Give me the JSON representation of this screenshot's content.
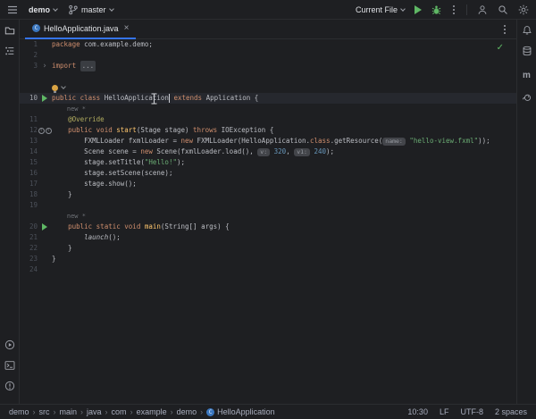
{
  "titlebar": {
    "project_name": "demo",
    "branch_name": "master",
    "run_config": "Current File"
  },
  "tab_bar": {
    "active_tab": "HelloApplication.java"
  },
  "icons": {
    "close": "×",
    "check": "✓",
    "fold_arrow": "›",
    "override_arrow": "↑",
    "breadcrumb_separator": "›",
    "class_letter": "C",
    "maven": "m"
  },
  "colors": {
    "accent_blue": "#3574F0",
    "run_green": "#5FB865",
    "keyword_orange": "#CF8E6D",
    "string_green": "#6AAB73",
    "number_blue": "#6897BB",
    "annotation_yellow": "#B3AE60",
    "method_yellow": "#FFC66D",
    "background": "#1E1F22"
  },
  "editor": {
    "rows": [
      {
        "n": "1",
        "seg": [
          {
            "t": "package ",
            "c": "kw"
          },
          {
            "t": "com.example.demo;",
            "c": "def"
          }
        ]
      },
      {
        "n": "2",
        "seg": []
      },
      {
        "n": "3",
        "gutter": "fold",
        "seg": [
          {
            "t": "import ",
            "c": "kw"
          },
          {
            "t": "...",
            "c": "fold"
          }
        ]
      },
      {
        "n": "",
        "seg": []
      },
      {
        "n": "",
        "bulb": true,
        "seg": []
      },
      {
        "n": "10",
        "current": true,
        "gutter": "run",
        "seg": [
          {
            "t": "public class ",
            "c": "kw"
          },
          {
            "t": "HelloApplication",
            "c": "def"
          },
          {
            "caret": true
          },
          {
            "t": " ",
            "c": "def"
          },
          {
            "t": "extends",
            "c": "kw"
          },
          {
            "t": " Application {",
            "c": "def"
          }
        ]
      },
      {
        "n": "",
        "seg": [
          {
            "t": "    new *",
            "c": "vision"
          }
        ]
      },
      {
        "n": "11",
        "seg": [
          {
            "t": "    ",
            "c": "def"
          },
          {
            "t": "@Override",
            "c": "ann"
          }
        ]
      },
      {
        "n": "12",
        "gutter": "override",
        "seg": [
          {
            "t": "    ",
            "c": "def"
          },
          {
            "t": "public void ",
            "c": "kw"
          },
          {
            "t": "start",
            "c": "mth"
          },
          {
            "t": "(Stage stage) ",
            "c": "def"
          },
          {
            "t": "throws",
            "c": "kw"
          },
          {
            "t": " IOException {",
            "c": "def"
          }
        ]
      },
      {
        "n": "13",
        "seg": [
          {
            "t": "        FXMLLoader fxmlLoader = ",
            "c": "def"
          },
          {
            "t": "new",
            "c": "kw"
          },
          {
            "t": " FXMLLoader(HelloApplication.",
            "c": "def"
          },
          {
            "t": "class",
            "c": "kw"
          },
          {
            "t": ".getResource(",
            "c": "def"
          },
          {
            "t": "name:",
            "c": "chip"
          },
          {
            "t": " ",
            "c": "def"
          },
          {
            "t": "\"hello-view.fxml\"",
            "c": "str"
          },
          {
            "t": "));",
            "c": "def"
          }
        ]
      },
      {
        "n": "14",
        "seg": [
          {
            "t": "        Scene scene = ",
            "c": "def"
          },
          {
            "t": "new",
            "c": "kw"
          },
          {
            "t": " Scene(fxmlLoader.load(), ",
            "c": "def"
          },
          {
            "t": "v:",
            "c": "chip"
          },
          {
            "t": " ",
            "c": "def"
          },
          {
            "t": "320",
            "c": "num"
          },
          {
            "t": ", ",
            "c": "def"
          },
          {
            "t": "v1:",
            "c": "chip"
          },
          {
            "t": " ",
            "c": "def"
          },
          {
            "t": "240",
            "c": "num"
          },
          {
            "t": ");",
            "c": "def"
          }
        ]
      },
      {
        "n": "15",
        "seg": [
          {
            "t": "        stage.setTitle(",
            "c": "def"
          },
          {
            "t": "\"Hello!\"",
            "c": "str"
          },
          {
            "t": ");",
            "c": "def"
          }
        ]
      },
      {
        "n": "16",
        "seg": [
          {
            "t": "        stage.setScene(scene);",
            "c": "def"
          }
        ]
      },
      {
        "n": "17",
        "seg": [
          {
            "t": "        stage.show();",
            "c": "def"
          }
        ]
      },
      {
        "n": "18",
        "seg": [
          {
            "t": "    }",
            "c": "def"
          }
        ]
      },
      {
        "n": "19",
        "seg": []
      },
      {
        "n": "",
        "seg": [
          {
            "t": "    new *",
            "c": "vision"
          }
        ]
      },
      {
        "n": "20",
        "gutter": "run",
        "seg": [
          {
            "t": "    ",
            "c": "def"
          },
          {
            "t": "public static void ",
            "c": "kw"
          },
          {
            "t": "main",
            "c": "mth"
          },
          {
            "t": "(String[] args) {",
            "c": "def"
          }
        ]
      },
      {
        "n": "21",
        "seg": [
          {
            "t": "        ",
            "c": "def"
          },
          {
            "t": "launch",
            "c": "itl"
          },
          {
            "t": "();",
            "c": "def"
          }
        ]
      },
      {
        "n": "22",
        "seg": [
          {
            "t": "    }",
            "c": "def"
          }
        ]
      },
      {
        "n": "23",
        "seg": [
          {
            "t": "}",
            "c": "def"
          }
        ]
      },
      {
        "n": "24",
        "seg": []
      }
    ]
  },
  "status_bar": {
    "breadcrumbs": [
      "demo",
      "src",
      "main",
      "java",
      "com",
      "example",
      "demo",
      "HelloApplication"
    ],
    "caret_position": "10:30",
    "line_separator": "LF",
    "encoding": "UTF-8",
    "indent": "2 spaces"
  }
}
